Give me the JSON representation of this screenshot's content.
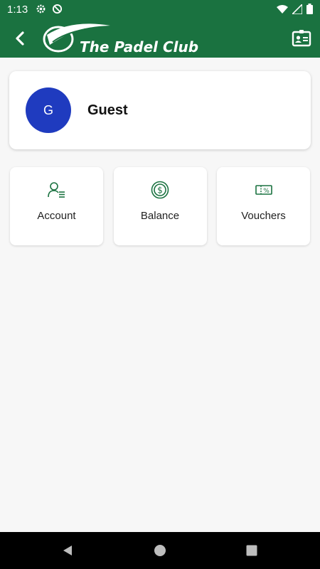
{
  "status_bar": {
    "time": "1:13",
    "icons": [
      "settings-icon",
      "do-not-disturb-icon",
      "wifi-icon",
      "signal-icon",
      "battery-icon"
    ]
  },
  "app_bar": {
    "brand_name": "The Padel Club",
    "background_color": "#1a7240"
  },
  "user": {
    "initial": "G",
    "name": "Guest",
    "avatar_color": "#1f3bbf"
  },
  "tiles": [
    {
      "label": "Account",
      "icon": "account-icon"
    },
    {
      "label": "Balance",
      "icon": "dollar-coin-icon"
    },
    {
      "label": "Vouchers",
      "icon": "voucher-icon"
    }
  ],
  "accent_color": "#1a7240"
}
